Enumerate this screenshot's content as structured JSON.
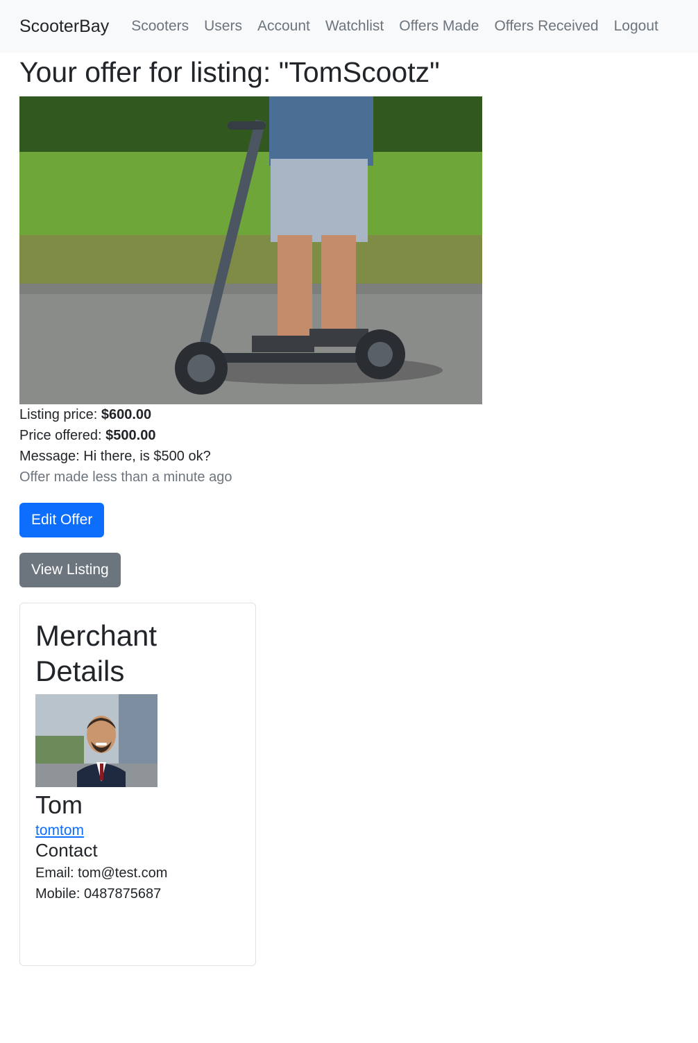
{
  "navbar": {
    "brand": "ScooterBay",
    "links": [
      "Scooters",
      "Users",
      "Account",
      "Watchlist",
      "Offers Made",
      "Offers Received",
      "Logout"
    ]
  },
  "page": {
    "title": "Your offer for listing: \"TomScootz\""
  },
  "offer": {
    "listing_price_label": "Listing price:",
    "listing_price": "$600.00",
    "price_offered_label": "Price offered:",
    "price_offered": "$500.00",
    "message_label": "Message:",
    "message": "Hi there, is $500 ok?",
    "timestamp": "Offer made less than a minute ago",
    "edit_button": "Edit Offer",
    "view_button": "View Listing"
  },
  "merchant": {
    "heading": "Merchant Details",
    "name": "Tom",
    "username": "tomtom",
    "contact_heading": "Contact",
    "email_label": "Email:",
    "email": "tom@test.com",
    "mobile_label": "Mobile:",
    "mobile": "0487875687"
  },
  "colors": {
    "primary": "#0d6efd",
    "secondary": "#6c757d",
    "navbar_bg": "#f8f9fa"
  }
}
